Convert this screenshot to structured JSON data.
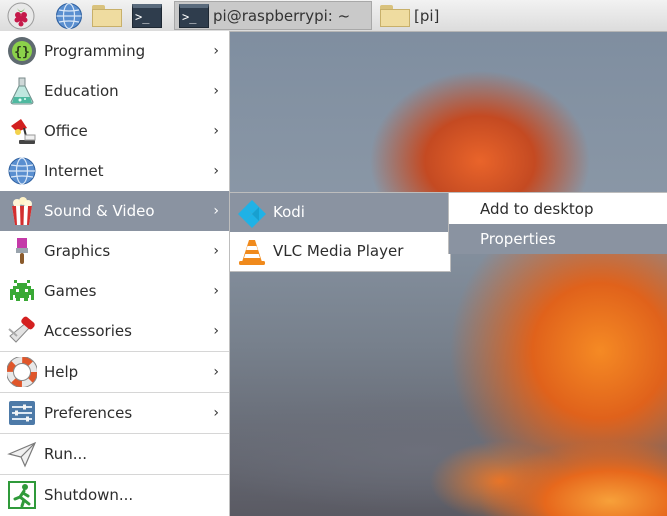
{
  "taskbar": {
    "menu_button_icon": "raspberry-icon",
    "launchers": [
      {
        "name": "web-browser",
        "icon": "globe-icon"
      },
      {
        "name": "file-manager",
        "icon": "folder-icon"
      },
      {
        "name": "terminal",
        "icon": "terminal-icon"
      }
    ],
    "tasks": [
      {
        "title": "pi@raspberrypi: ~",
        "icon": "terminal-icon",
        "active": true
      },
      {
        "title": "[pi]",
        "icon": "folder-icon",
        "active": false
      }
    ]
  },
  "menu": {
    "items": [
      {
        "label": "Programming",
        "icon": "programming-icon",
        "arrow": "›"
      },
      {
        "label": "Education",
        "icon": "flask-icon",
        "arrow": "›"
      },
      {
        "label": "Office",
        "icon": "desk-lamp-icon",
        "arrow": "›"
      },
      {
        "label": "Internet",
        "icon": "globe-icon",
        "arrow": "›"
      },
      {
        "label": "Sound & Video",
        "icon": "popcorn-icon",
        "arrow": "›",
        "highlighted": true
      },
      {
        "label": "Graphics",
        "icon": "paintbrush-icon",
        "arrow": "›"
      },
      {
        "label": "Games",
        "icon": "space-invader-icon",
        "arrow": "›"
      },
      {
        "label": "Accessories",
        "icon": "pocket-knife-icon",
        "arrow": "›"
      },
      {
        "label": "Help",
        "icon": "lifebuoy-icon",
        "arrow": "›"
      },
      {
        "label": "Preferences",
        "icon": "sliders-icon",
        "arrow": "›"
      },
      {
        "label": "Run...",
        "icon": "paper-plane-icon"
      },
      {
        "label": "Shutdown...",
        "icon": "exit-icon"
      }
    ]
  },
  "submenu": {
    "items": [
      {
        "label": "Kodi",
        "icon": "kodi-icon",
        "highlighted": true
      },
      {
        "label": "VLC Media Player",
        "icon": "vlc-cone-icon"
      }
    ]
  },
  "context_menu": {
    "items": [
      {
        "label": "Add to desktop"
      },
      {
        "label": "Properties",
        "highlighted": true
      }
    ]
  },
  "colors": {
    "highlight": "#8a93a1",
    "menu_bg": "#ffffff",
    "taskbar_bg": "#e6e6e6"
  }
}
